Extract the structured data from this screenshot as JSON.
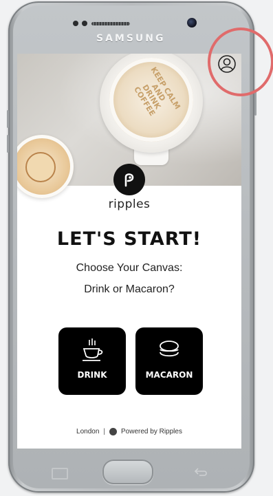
{
  "device": {
    "brand": "SAMSUNG"
  },
  "hero": {
    "cup_lettering": "KEEP CALM AND DRINK COFFEE"
  },
  "logo": {
    "wordmark": "ripples"
  },
  "main": {
    "headline": "LET'S START!",
    "subtitle_line1": "Choose Your Canvas:",
    "subtitle_line2": "Drink or Macaron?"
  },
  "choices": [
    {
      "label": "DRINK",
      "icon": "coffee-cup-icon"
    },
    {
      "label": "MACARON",
      "icon": "macaron-icon"
    }
  ],
  "footer": {
    "location": "London",
    "separator": "|",
    "powered_by": "Powered by Ripples"
  },
  "colors": {
    "button_bg": "#000000",
    "button_text": "#ffffff",
    "annotation": "#e06b6b"
  }
}
